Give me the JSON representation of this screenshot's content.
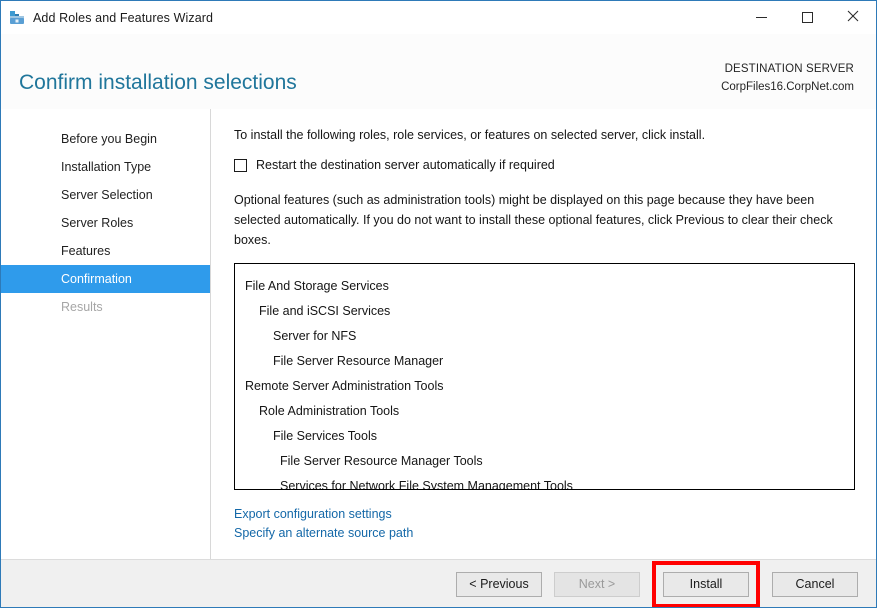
{
  "window": {
    "title": "Add Roles and Features Wizard",
    "app_icon": "wizard-toolbox-icon",
    "caption": {
      "minimize": "minimize-icon",
      "maximize": "maximize-icon",
      "close": "✕"
    }
  },
  "header": {
    "page_title": "Confirm installation selections",
    "destination_label": "DESTINATION SERVER",
    "destination_server": "CorpFiles16.CorpNet.com",
    "title_color": "#20769b"
  },
  "sidebar": {
    "items": [
      {
        "label": "Before you Begin",
        "state": "normal"
      },
      {
        "label": "Installation Type",
        "state": "normal"
      },
      {
        "label": "Server Selection",
        "state": "normal"
      },
      {
        "label": "Server Roles",
        "state": "normal"
      },
      {
        "label": "Features",
        "state": "normal"
      },
      {
        "label": "Confirmation",
        "state": "active"
      },
      {
        "label": "Results",
        "state": "disabled"
      }
    ],
    "active_color": "#2f9beb"
  },
  "main": {
    "intro_text": "To install the following roles, role services, or features on selected server, click install.",
    "restart_checkbox": {
      "label": "Restart the destination server automatically if required",
      "checked": false
    },
    "optional_note": "Optional features (such as administration tools) might be displayed on this page because they have been selected automatically. If you do not want to install these optional features, click Previous to clear their check boxes.",
    "selections": [
      {
        "label": "File And Storage Services",
        "level": 0
      },
      {
        "label": "File and iSCSI Services",
        "level": 1
      },
      {
        "label": "Server for NFS",
        "level": 2
      },
      {
        "label": "File Server Resource Manager",
        "level": 2
      },
      {
        "label": "Remote Server Administration Tools",
        "level": 0
      },
      {
        "label": "Role Administration Tools",
        "level": 1
      },
      {
        "label": "File Services Tools",
        "level": 2
      },
      {
        "label": "File Server Resource Manager Tools",
        "level": 3
      },
      {
        "label": "Services for Network File System Management Tools",
        "level": 3
      }
    ],
    "links": [
      {
        "label": "Export configuration settings"
      },
      {
        "label": "Specify an alternate source path"
      }
    ],
    "link_color": "#1468a8"
  },
  "footer": {
    "buttons": [
      {
        "label": "< Previous",
        "state": "normal",
        "name": "previous-button"
      },
      {
        "label": "Next >",
        "state": "disabled",
        "name": "next-button"
      },
      {
        "label": "Install",
        "state": "highlighted",
        "name": "install-button"
      },
      {
        "label": "Cancel",
        "state": "normal",
        "name": "cancel-button"
      }
    ],
    "highlight_color": "#ff0000"
  }
}
